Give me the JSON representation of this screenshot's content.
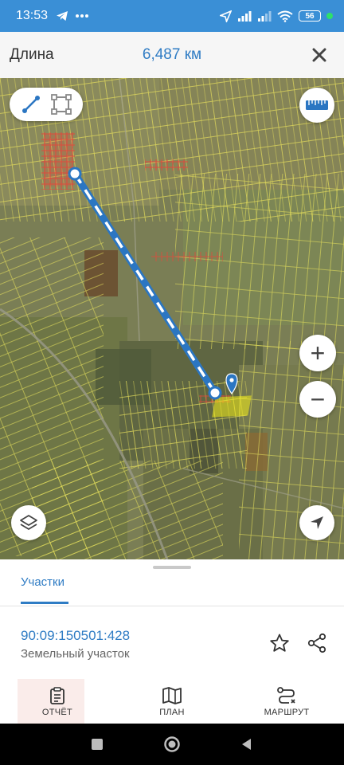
{
  "status_bar": {
    "time": "13:53",
    "battery": "56",
    "icons": [
      "telegram-icon",
      "more-dots-icon",
      "location-arrow-icon",
      "signal-icon",
      "signal-icon",
      "wifi-icon",
      "battery-icon"
    ]
  },
  "header": {
    "title": "Длина",
    "distance": "6,487 км",
    "close_icon": "close-icon"
  },
  "map": {
    "tools": [
      "line-measure-icon",
      "area-measure-icon"
    ],
    "ruler_icon": "ruler-icon",
    "zoom_in": "+",
    "zoom_out": "−",
    "layers_icon": "layers-icon",
    "locate_icon": "navigation-arrow-icon",
    "colors": {
      "parcel_outline": "#e6e05a",
      "selected_parcel": "#f5ef1a",
      "measure_line": "#2b76c2",
      "urban_parcels": "#e04a3c"
    }
  },
  "sheet": {
    "tab": "Участки",
    "parcel": {
      "id": "90:09:150501:428",
      "type": "Земельный участок"
    }
  },
  "bottom_nav": [
    {
      "label": "ОТЧЁТ",
      "icon": "report-clipboard-icon"
    },
    {
      "label": "ПЛАН",
      "icon": "map-icon"
    },
    {
      "label": "МАРШРУТ",
      "icon": "route-icon"
    }
  ],
  "system_nav": [
    "square-icon",
    "circle-icon",
    "back-triangle-icon"
  ]
}
